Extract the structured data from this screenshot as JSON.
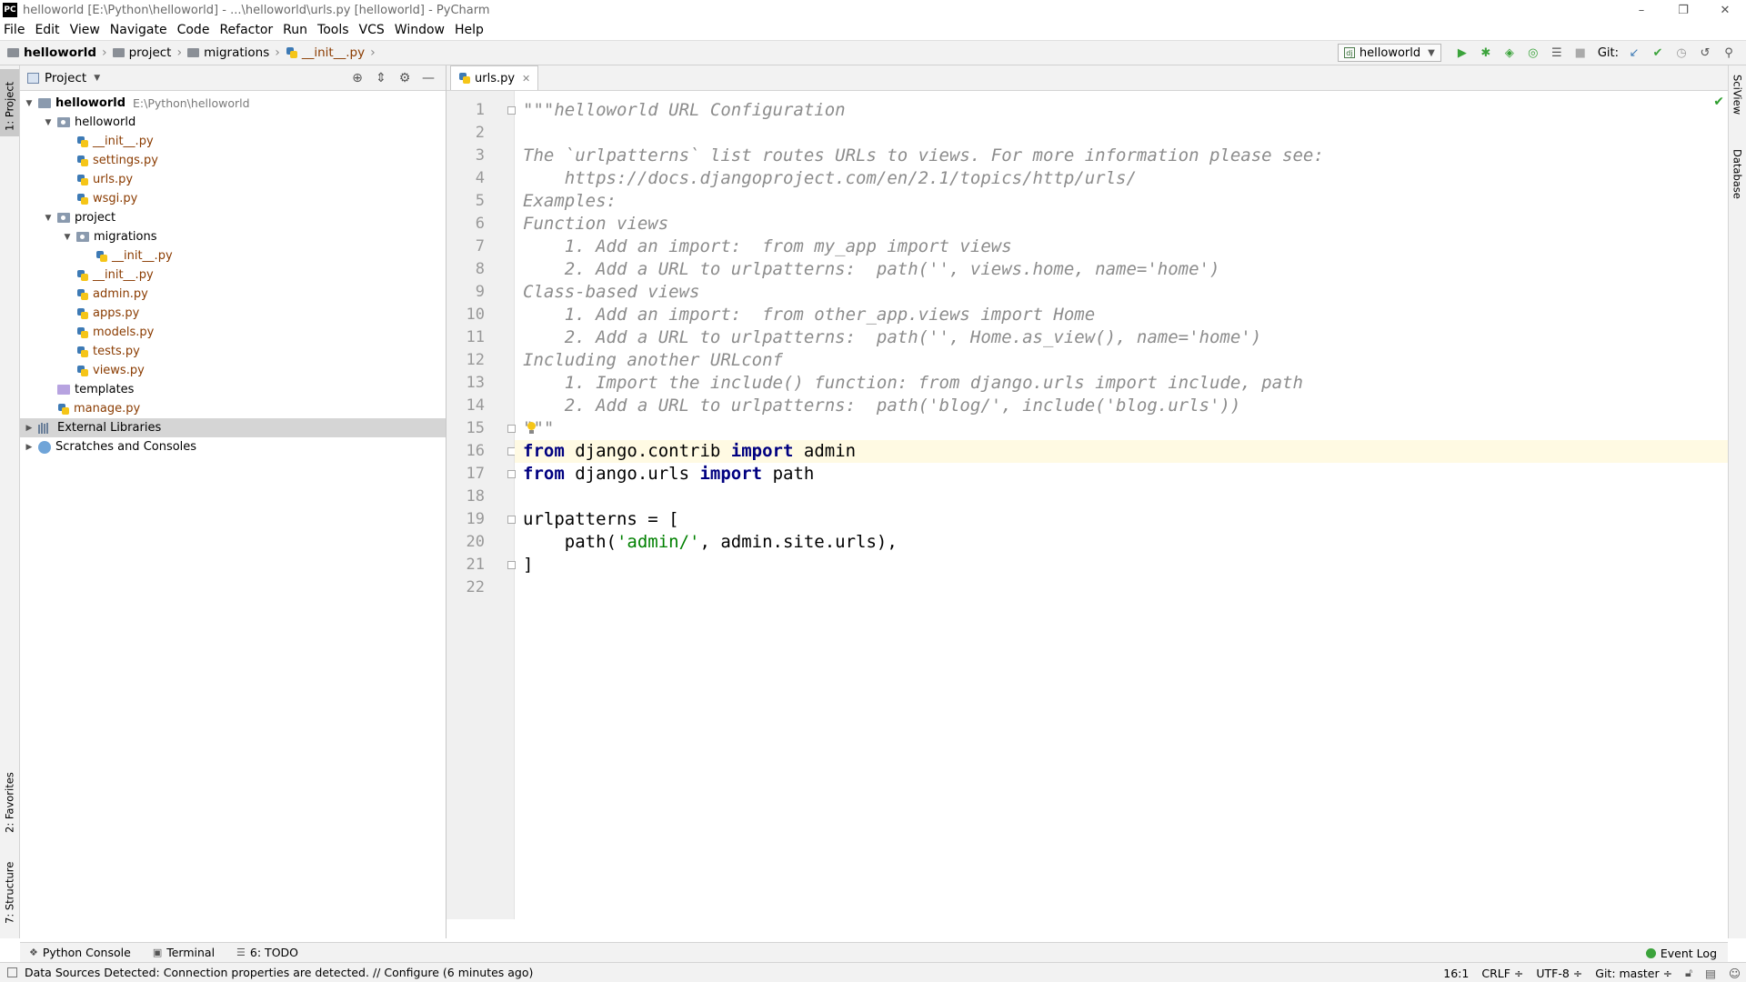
{
  "window": {
    "title": "helloworld [E:\\Python\\helloworld] - ...\\helloworld\\urls.py [helloworld] - PyCharm",
    "app_icon": "PC",
    "controls": [
      "–",
      "❐",
      "✕"
    ]
  },
  "menu": [
    "File",
    "Edit",
    "View",
    "Navigate",
    "Code",
    "Refactor",
    "Run",
    "Tools",
    "VCS",
    "Window",
    "Help"
  ],
  "breadcrumbs": [
    "helloworld",
    "project",
    "migrations",
    "__init__.py"
  ],
  "toolbar": {
    "run_config": "helloworld",
    "git_label": "Git:"
  },
  "left_tabs": {
    "project": "1: Project",
    "favorites": "2: Favorites",
    "structure": "7: Structure"
  },
  "right_tabs": {
    "sciview": "SciView",
    "database": "Database"
  },
  "project_panel": {
    "title": "Project",
    "tree": [
      {
        "label": "helloworld",
        "path": "E:\\Python\\helloworld",
        "depth": 0,
        "kind": "root",
        "expanded": true
      },
      {
        "label": "helloworld",
        "depth": 1,
        "kind": "pkg",
        "expanded": true
      },
      {
        "label": "__init__.py",
        "depth": 2,
        "kind": "py"
      },
      {
        "label": "settings.py",
        "depth": 2,
        "kind": "py"
      },
      {
        "label": "urls.py",
        "depth": 2,
        "kind": "py"
      },
      {
        "label": "wsgi.py",
        "depth": 2,
        "kind": "py"
      },
      {
        "label": "project",
        "depth": 1,
        "kind": "pkg",
        "expanded": true
      },
      {
        "label": "migrations",
        "depth": 2,
        "kind": "pkg",
        "expanded": true
      },
      {
        "label": "__init__.py",
        "depth": 3,
        "kind": "py"
      },
      {
        "label": "__init__.py",
        "depth": 2,
        "kind": "py"
      },
      {
        "label": "admin.py",
        "depth": 2,
        "kind": "py"
      },
      {
        "label": "apps.py",
        "depth": 2,
        "kind": "py"
      },
      {
        "label": "models.py",
        "depth": 2,
        "kind": "py"
      },
      {
        "label": "tests.py",
        "depth": 2,
        "kind": "py"
      },
      {
        "label": "views.py",
        "depth": 2,
        "kind": "py"
      },
      {
        "label": "templates",
        "depth": 1,
        "kind": "templates"
      },
      {
        "label": "manage.py",
        "depth": 1,
        "kind": "py"
      },
      {
        "label": "External Libraries",
        "depth": 0,
        "kind": "lib",
        "expanded": false,
        "selected": true
      },
      {
        "label": "Scratches and Consoles",
        "depth": 0,
        "kind": "scratch",
        "expanded": false
      }
    ]
  },
  "editor": {
    "tab": "urls.py",
    "current_line": 16,
    "lines": [
      [
        [
          "doc",
          "\"\"\"helloworld URL Configuration"
        ]
      ],
      [],
      [
        [
          "doc",
          "The `urlpatterns` list routes URLs to views. For more information please see:"
        ]
      ],
      [
        [
          "doc",
          "    https://docs.djangoproject.com/en/2.1/topics/http/urls/"
        ]
      ],
      [
        [
          "doc",
          "Examples:"
        ]
      ],
      [
        [
          "doc",
          "Function views"
        ]
      ],
      [
        [
          "doc",
          "    1. Add an import:  from my_app import views"
        ]
      ],
      [
        [
          "doc",
          "    2. Add a URL to urlpatterns:  path('', views.home, name='home')"
        ]
      ],
      [
        [
          "doc",
          "Class-based views"
        ]
      ],
      [
        [
          "doc",
          "    1. Add an import:  from other_app.views import Home"
        ]
      ],
      [
        [
          "doc",
          "    2. Add a URL to urlpatterns:  path('', Home.as_view(), name='home')"
        ]
      ],
      [
        [
          "doc",
          "Including another URLconf"
        ]
      ],
      [
        [
          "doc",
          "    1. Import the include() function: from django.urls import include, path"
        ]
      ],
      [
        [
          "doc",
          "    2. Add a URL to urlpatterns:  path('blog/', include('blog.urls'))"
        ]
      ],
      [
        [
          "doc",
          "\"\"\""
        ]
      ],
      [
        [
          "kw",
          "from"
        ],
        [
          "plain",
          " django.contrib "
        ],
        [
          "kw",
          "import"
        ],
        [
          "plain",
          " admin"
        ]
      ],
      [
        [
          "kw",
          "from"
        ],
        [
          "plain",
          " django.urls "
        ],
        [
          "kw",
          "import"
        ],
        [
          "plain",
          " path"
        ]
      ],
      [],
      [
        [
          "plain",
          "urlpatterns = ["
        ]
      ],
      [
        [
          "plain",
          "    path("
        ],
        [
          "str",
          "'admin/'"
        ],
        [
          "plain",
          ", admin.site.urls),"
        ]
      ],
      [
        [
          "plain",
          "]"
        ]
      ],
      []
    ]
  },
  "bottom_tools": [
    {
      "label": "Python Console",
      "icon": "python-icon"
    },
    {
      "label": "Terminal",
      "icon": "terminal-icon"
    },
    {
      "label": "6: TODO",
      "icon": "todo-icon"
    }
  ],
  "event_log": "Event Log",
  "status": {
    "message": "Data Sources Detected: Connection properties are detected. // Configure (6 minutes ago)",
    "position": "16:1",
    "line_sep": "CRLF ÷",
    "encoding": "UTF-8 ÷",
    "git": "Git: master ÷"
  },
  "colors": {
    "keyword": "#000080",
    "string": "#008000",
    "docstring": "#8c8c8c",
    "py_file": "#8a3b00",
    "current_line": "#fffae3"
  }
}
